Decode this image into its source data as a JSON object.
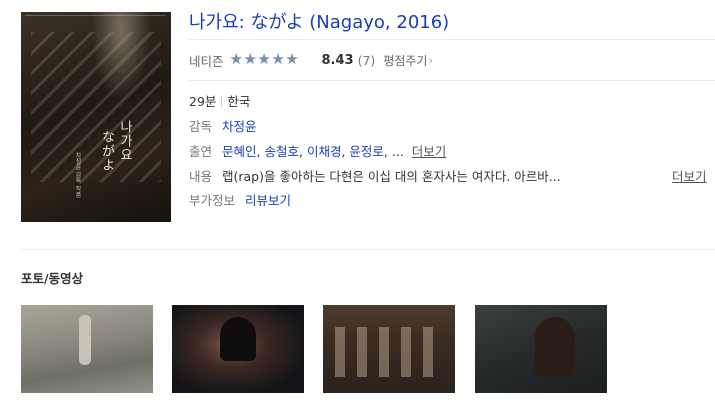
{
  "movie": {
    "title": "나가요: ながよ (Nagayo, 2016)",
    "poster": {
      "title_line1": "나가요",
      "title_line2": "ながよ",
      "credit": "차정윤 감독 작품"
    }
  },
  "rating": {
    "label": "네티즌",
    "score": "8.43",
    "score_value": 8.43,
    "score_max": 10,
    "count": "(7)",
    "rate_button": "평점주기",
    "star_color": "#778fb0"
  },
  "info": {
    "runtime": "29분",
    "country": "한국",
    "director_label": "감독",
    "director": "차정윤",
    "cast_label": "출연",
    "cast": [
      "문혜인",
      "송철호",
      "이채경",
      "윤정로"
    ],
    "cast_ellipsis": "...",
    "more": "더보기",
    "plot_label": "내용",
    "plot": "랩(rap)을 좋아하는 다현은 이십 대의 혼자사는 여자다. 아르바...",
    "extra_label": "부가정보",
    "extra_link": "리뷰보기"
  },
  "media": {
    "section_title": "포토/동영상"
  },
  "colors": {
    "link": "#1a3dbd",
    "text": "#333333"
  }
}
